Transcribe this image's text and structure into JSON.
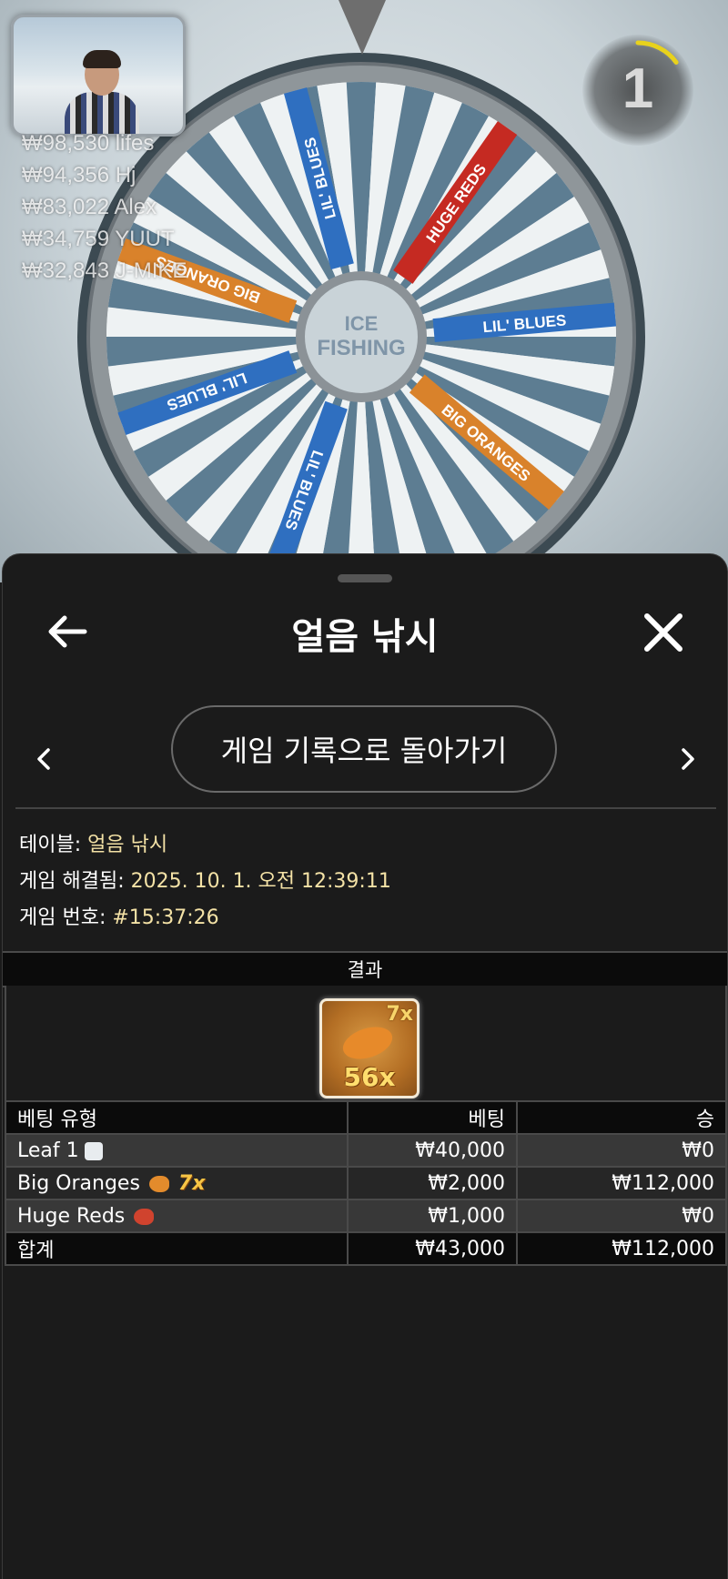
{
  "game": {
    "leaderboard": [
      "₩98,530 lifes",
      "₩94,356 Hj",
      "₩83,022 Alex",
      "₩34,759 YUUT",
      "₩32,843 J-MIKE"
    ],
    "timer_value": "1",
    "timer_progress": 0.15,
    "wheel_center_label": [
      "ICE",
      "FISHING"
    ],
    "wheel_segment_labels": [
      "LIL' BLUES",
      "HUGE REDS",
      "LIL' BLUES",
      "BIG ORANGES",
      "LIL' BLUES",
      "LIL' BLUES",
      "BIG ORANGES"
    ]
  },
  "sheet": {
    "title": "얼음 낚시",
    "back_icon": "arrow-left-icon",
    "close_icon": "close-icon",
    "history_button_label": "게임 기록으로 돌아가기",
    "info": {
      "table_label": "테이블:",
      "table_value": "얼음 낚시",
      "resolved_label": "게임 해결됨:",
      "resolved_value": "2025. 10. 1. 오전 12:39:11",
      "number_label": "게임 번호:",
      "number_value": "#15:37:26"
    },
    "result_header": "결과",
    "result_tile": {
      "top_multiplier": "7x",
      "bottom_multiplier": "56x"
    },
    "bets_table": {
      "headers": [
        "베팅 유형",
        "베팅",
        "승"
      ],
      "rows": [
        {
          "type": "Leaf 1",
          "bet": "₩40,000",
          "win": "₩0"
        },
        {
          "type": "Big Oranges",
          "multiplier": "7x",
          "bet": "₩2,000",
          "win": "₩112,000"
        },
        {
          "type": "Huge Reds",
          "bet": "₩1,000",
          "win": "₩0"
        }
      ],
      "total": {
        "label": "합계",
        "bet": "₩43,000",
        "win": "₩112,000"
      }
    }
  }
}
